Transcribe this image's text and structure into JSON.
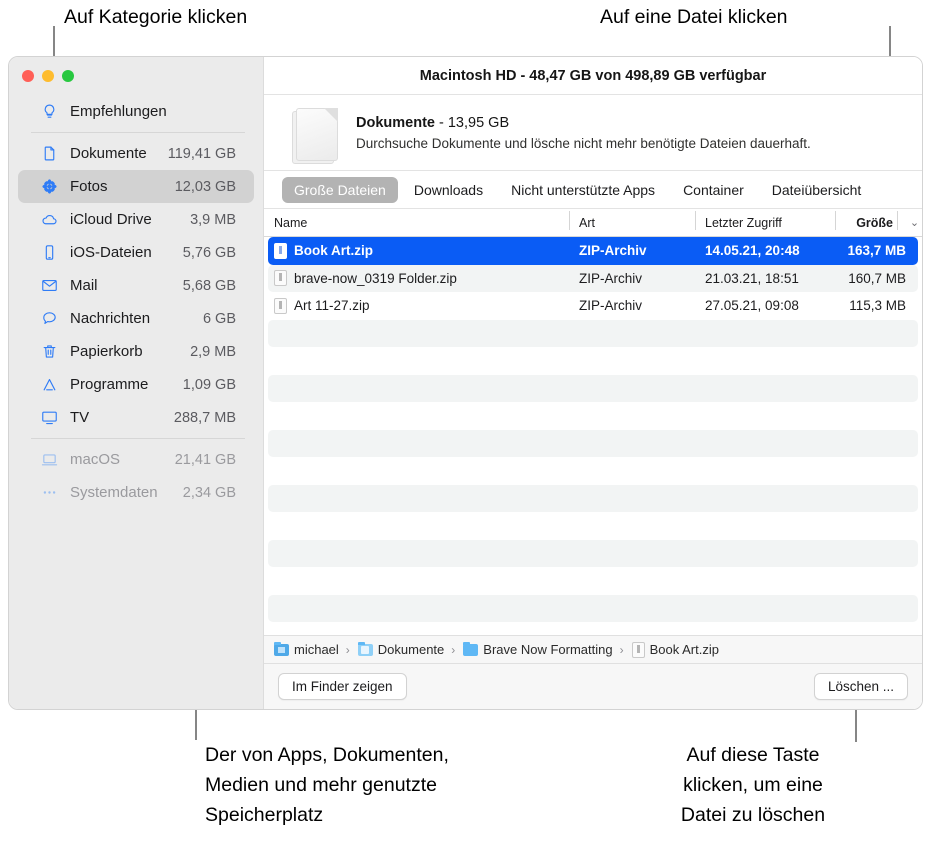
{
  "annotations": {
    "top_left": "Auf Kategorie klicken",
    "top_right": "Auf eine Datei klicken",
    "bottom_left": "Der von Apps, Dokumenten,\nMedien und mehr genutzte\nSpeicherplatz",
    "bottom_right": "Auf diese Taste\nklicken, um eine\nDatei zu löschen"
  },
  "window": {
    "title": "Macintosh HD - 48,47 GB von 498,89 GB verfügbar"
  },
  "sidebar": {
    "items": [
      {
        "label": "Empfehlungen",
        "size": "",
        "icon": "lightbulb-icon",
        "selected": false,
        "dim": false
      },
      {
        "label": "Dokumente",
        "size": "119,41 GB",
        "icon": "document-icon",
        "selected": false,
        "dim": false
      },
      {
        "label": "Fotos",
        "size": "12,03 GB",
        "icon": "photos-icon",
        "selected": true,
        "dim": false
      },
      {
        "label": "iCloud Drive",
        "size": "3,9 MB",
        "icon": "cloud-icon",
        "selected": false,
        "dim": false
      },
      {
        "label": "iOS-Dateien",
        "size": "5,76 GB",
        "icon": "iphone-icon",
        "selected": false,
        "dim": false
      },
      {
        "label": "Mail",
        "size": "5,68 GB",
        "icon": "mail-icon",
        "selected": false,
        "dim": false
      },
      {
        "label": "Nachrichten",
        "size": "6 GB",
        "icon": "chat-icon",
        "selected": false,
        "dim": false
      },
      {
        "label": "Papierkorb",
        "size": "2,9 MB",
        "icon": "trash-icon",
        "selected": false,
        "dim": false
      },
      {
        "label": "Programme",
        "size": "1,09 GB",
        "icon": "appstore-icon",
        "selected": false,
        "dim": false
      },
      {
        "label": "TV",
        "size": "288,7 MB",
        "icon": "tv-icon",
        "selected": false,
        "dim": false
      },
      {
        "label": "macOS",
        "size": "21,41 GB",
        "icon": "laptop-icon",
        "selected": false,
        "dim": true
      },
      {
        "label": "Systemdaten",
        "size": "2,34 GB",
        "icon": "ellipsis-icon",
        "selected": false,
        "dim": true
      }
    ]
  },
  "category_header": {
    "name": "Dokumente",
    "size": " - 13,95 GB",
    "description": "Durchsuche Dokumente und lösche nicht mehr benötigte Dateien dauerhaft."
  },
  "tabs": [
    {
      "label": "Große Dateien",
      "active": true
    },
    {
      "label": "Downloads",
      "active": false
    },
    {
      "label": "Nicht unterstützte Apps",
      "active": false
    },
    {
      "label": "Container",
      "active": false
    },
    {
      "label": "Dateiübersicht",
      "active": false
    }
  ],
  "table": {
    "columns": [
      "Name",
      "Art",
      "Letzter Zugriff",
      "Größe"
    ],
    "sort_chevron": "⌄",
    "rows": [
      {
        "name": "Book Art.zip",
        "art": "ZIP-Archiv",
        "date": "14.05.21, 20:48",
        "size": "163,7 MB",
        "selected": true
      },
      {
        "name": "brave-now_0319 Folder.zip",
        "art": "ZIP-Archiv",
        "date": "21.03.21, 18:51",
        "size": "160,7 MB",
        "selected": false
      },
      {
        "name": "Art 11-27.zip",
        "art": "ZIP-Archiv",
        "date": "27.05.21, 09:08",
        "size": "115,3 MB",
        "selected": false
      }
    ],
    "empty_row_count": 11
  },
  "breadcrumb": [
    {
      "label": "michael",
      "icon": "home-folder-icon"
    },
    {
      "label": "Dokumente",
      "icon": "documents-folder-icon"
    },
    {
      "label": "Brave Now Formatting",
      "icon": "folder-icon"
    },
    {
      "label": "Book Art.zip",
      "icon": "zip-file-icon"
    }
  ],
  "footer": {
    "reveal_label": "Im Finder zeigen",
    "delete_label": "Löschen ..."
  },
  "colors": {
    "accent_blue": "#0a5cf5",
    "sidebar_icon_blue": "#2f7cf6",
    "sidebar_bg": "#ebebeb",
    "stripe": "#f2f4f4",
    "leader_line": "#868686"
  }
}
